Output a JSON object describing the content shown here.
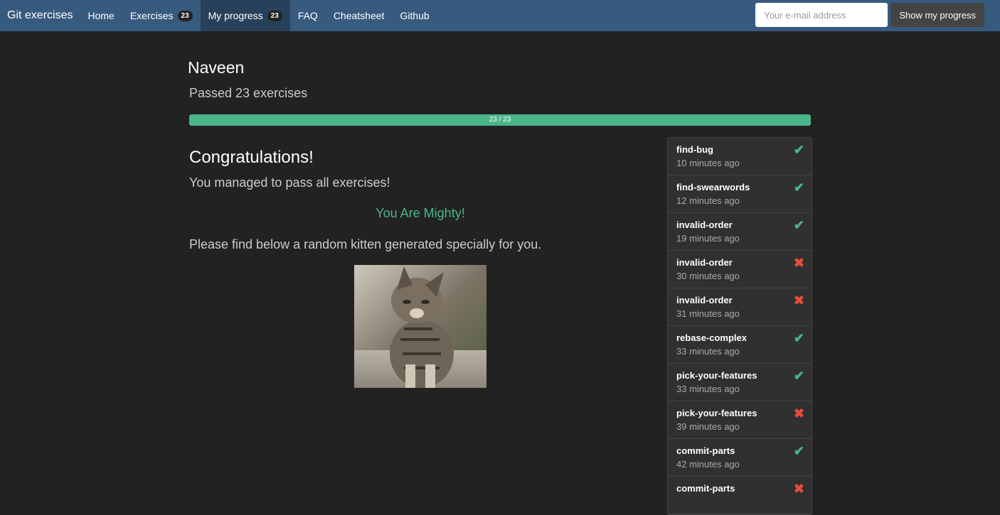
{
  "nav": {
    "brand": "Git exercises",
    "home": "Home",
    "exercises": "Exercises",
    "exercises_count": "23",
    "my_progress": "My progress",
    "my_progress_count": "23",
    "faq": "FAQ",
    "cheatsheet": "Cheatsheet",
    "github": "Github",
    "email_placeholder": "Your e-mail address",
    "show_progress": "Show my progress"
  },
  "main": {
    "name": "Naveen",
    "passed": "Passed 23 exercises",
    "progress_text": "23 / 23",
    "progress_fraction": 1.0,
    "congrats": "Congratulations!",
    "managed": "You managed to pass all exercises!",
    "mighty": "You Are Mighty!",
    "kitten_text": "Please find below a random kitten generated specially for you."
  },
  "history": [
    {
      "name": "find-bug",
      "time": "10 minutes ago",
      "status": "passed"
    },
    {
      "name": "find-swearwords",
      "time": "12 minutes ago",
      "status": "passed"
    },
    {
      "name": "invalid-order",
      "time": "19 minutes ago",
      "status": "passed"
    },
    {
      "name": "invalid-order",
      "time": "30 minutes ago",
      "status": "failed"
    },
    {
      "name": "invalid-order",
      "time": "31 minutes ago",
      "status": "failed"
    },
    {
      "name": "rebase-complex",
      "time": "33 minutes ago",
      "status": "passed"
    },
    {
      "name": "pick-your-features",
      "time": "33 minutes ago",
      "status": "passed"
    },
    {
      "name": "pick-your-features",
      "time": "39 minutes ago",
      "status": "failed"
    },
    {
      "name": "commit-parts",
      "time": "42 minutes ago",
      "status": "passed"
    },
    {
      "name": "commit-parts",
      "time": "",
      "status": "failed"
    }
  ],
  "colors": {
    "navbar": "#375a7f",
    "success": "#4bb688",
    "danger": "#e74c3c",
    "background": "#222222"
  }
}
